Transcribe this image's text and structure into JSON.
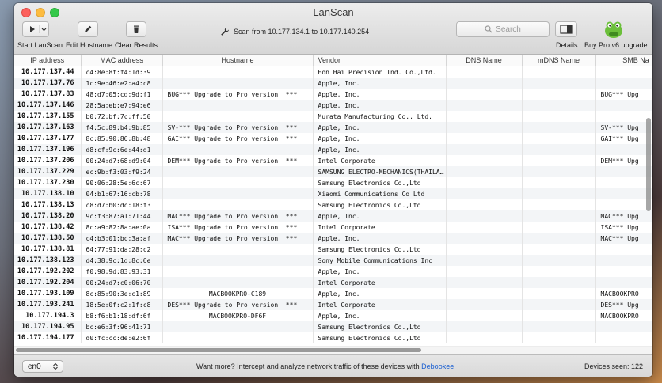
{
  "window": {
    "title": "LanScan"
  },
  "toolbar": {
    "start_label": "Start LanScan",
    "edit_label": "Edit Hostname",
    "clear_label": "Clear Results",
    "scan_range": "Scan from 10.177.134.1 to 10.177.140.254",
    "search_placeholder": "Search",
    "details_label": "Details",
    "buy_label": "Buy Pro v6 upgrade"
  },
  "table": {
    "headers": {
      "ip": "IP address",
      "mac": "MAC address",
      "hostname": "Hostname",
      "vendor": "Vendor",
      "dns": "DNS Name",
      "mdns": "mDNS Name",
      "smb": "SMB Na"
    },
    "rows": [
      {
        "ip": "10.177.137.44",
        "mac": "c4:8e:8f:f4:1d:39",
        "host": "",
        "vendor": "Hon Hai Precision Ind. Co.,Ltd.",
        "smb": ""
      },
      {
        "ip": "10.177.137.76",
        "mac": "1c:9e:46:e2:a4:c8",
        "host": "",
        "vendor": "Apple, Inc.",
        "smb": ""
      },
      {
        "ip": "10.177.137.83",
        "mac": "48:d7:05:cd:9d:f1",
        "host": "BUG*** Upgrade to Pro version! ***",
        "vendor": "Apple, Inc.",
        "smb": "BUG*** Upg"
      },
      {
        "ip": "10.177.137.146",
        "mac": "28:5a:eb:e7:94:e6",
        "host": "",
        "vendor": "Apple, Inc.",
        "smb": ""
      },
      {
        "ip": "10.177.137.155",
        "mac": "b0:72:bf:7c:ff:50",
        "host": "",
        "vendor": "Murata Manufacturing Co., Ltd.",
        "smb": ""
      },
      {
        "ip": "10.177.137.163",
        "mac": "f4:5c:89:b4:9b:85",
        "host": "SV-*** Upgrade to Pro version! ***",
        "vendor": "Apple, Inc.",
        "smb": "SV-*** Upg"
      },
      {
        "ip": "10.177.137.177",
        "mac": "8c:85:90:86:8b:48",
        "host": "GAI*** Upgrade to Pro version! ***",
        "vendor": "Apple, Inc.",
        "smb": "GAI*** Upg"
      },
      {
        "ip": "10.177.137.196",
        "mac": "d8:cf:9c:6e:44:d1",
        "host": "",
        "vendor": "Apple, Inc.",
        "smb": ""
      },
      {
        "ip": "10.177.137.206",
        "mac": "00:24:d7:68:d9:04",
        "host": "DEM*** Upgrade to Pro version! ***",
        "vendor": "Intel Corporate",
        "smb": "DEM*** Upg"
      },
      {
        "ip": "10.177.137.229",
        "mac": "ec:9b:f3:03:f9:24",
        "host": "",
        "vendor": "SAMSUNG ELECTRO-MECHANICS(THAILA…",
        "smb": ""
      },
      {
        "ip": "10.177.137.230",
        "mac": "90:06:28:5e:6c:67",
        "host": "",
        "vendor": "Samsung Electronics Co.,Ltd",
        "smb": ""
      },
      {
        "ip": "10.177.138.10",
        "mac": "04:b1:67:16:cb:78",
        "host": "",
        "vendor": "Xiaomi Communications Co Ltd",
        "smb": ""
      },
      {
        "ip": "10.177.138.13",
        "mac": "c8:d7:b0:dc:18:f3",
        "host": "",
        "vendor": "Samsung Electronics Co.,Ltd",
        "smb": ""
      },
      {
        "ip": "10.177.138.20",
        "mac": "9c:f3:87:a1:71:44",
        "host": "MAC*** Upgrade to Pro version! ***",
        "vendor": "Apple, Inc.",
        "smb": "MAC*** Upg"
      },
      {
        "ip": "10.177.138.42",
        "mac": "8c:a9:82:8a:ae:0a",
        "host": "ISA*** Upgrade to Pro version! ***",
        "vendor": "Intel Corporate",
        "smb": "ISA*** Upg"
      },
      {
        "ip": "10.177.138.50",
        "mac": "c4:b3:01:bc:3a:af",
        "host": "MAC*** Upgrade to Pro version! ***",
        "vendor": "Apple, Inc.",
        "smb": "MAC*** Upg"
      },
      {
        "ip": "10.177.138.81",
        "mac": "64:77:91:da:28:c2",
        "host": "",
        "vendor": "Samsung Electronics Co.,Ltd",
        "smb": ""
      },
      {
        "ip": "10.177.138.123",
        "mac": "d4:38:9c:1d:8c:6e",
        "host": "",
        "vendor": "Sony Mobile Communications Inc",
        "smb": ""
      },
      {
        "ip": "10.177.192.202",
        "mac": "f0:98:9d:83:93:31",
        "host": "",
        "vendor": "Apple, Inc.",
        "smb": ""
      },
      {
        "ip": "10.177.192.204",
        "mac": "00:24:d7:c0:06:70",
        "host": "",
        "vendor": "Intel Corporate",
        "smb": ""
      },
      {
        "ip": "10.177.193.109",
        "mac": "8c:85:90:3e:c1:89",
        "host": "MACBOOKPRO-C189",
        "vendor": "Apple, Inc.",
        "smb": "MACBOOKPRO"
      },
      {
        "ip": "10.177.193.241",
        "mac": "18:5e:0f:c2:1f:c8",
        "host": "DES*** Upgrade to Pro version! ***",
        "vendor": "Intel Corporate",
        "smb": "DES*** Upg"
      },
      {
        "ip": "10.177.194.3",
        "mac": "b8:f6:b1:18:df:6f",
        "host": "MACBOOKPRO-DF6F",
        "vendor": "Apple, Inc.",
        "smb": "MACBOOKPRO"
      },
      {
        "ip": "10.177.194.95",
        "mac": "bc:e6:3f:96:41:71",
        "host": "",
        "vendor": "Samsung Electronics Co.,Ltd",
        "smb": ""
      },
      {
        "ip": "10.177.194.177",
        "mac": "d0:fc:cc:de:e2:6f",
        "host": "",
        "vendor": "Samsung Electronics Co.,Ltd",
        "smb": ""
      }
    ]
  },
  "footer": {
    "interface": "en0",
    "promo_text": "Want more? Intercept and analyze network traffic of these devices with",
    "promo_link": "Debookee",
    "devices_seen": "Devices seen: 122"
  }
}
